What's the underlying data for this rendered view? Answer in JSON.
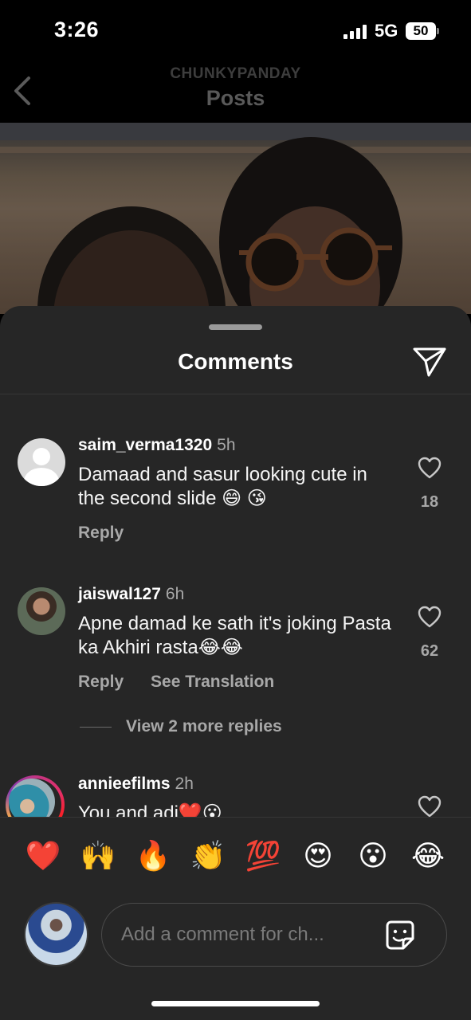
{
  "status_bar": {
    "time": "3:26",
    "network": "5G",
    "battery": "50"
  },
  "header": {
    "username": "CHUNKYPANDAY",
    "title": "Posts"
  },
  "sheet": {
    "title": "Comments"
  },
  "comments": [
    {
      "username": "saim_verma1320",
      "time": "5h",
      "text": "Damaad and sasur looking cute in the second slide 😄 😘",
      "likes": "18",
      "reply_label": "Reply"
    },
    {
      "username": "jaiswal127",
      "time": "6h",
      "text": "Apne damad ke sath it's joking Pasta ka Akhiri rasta😂😂",
      "likes": "62",
      "reply_label": "Reply",
      "translate_label": "See Translation",
      "view_replies": "View 2 more replies"
    },
    {
      "username": "annieefilms",
      "time": "2h",
      "text": "You and adi❤️😮"
    }
  ],
  "emoji_bar": [
    "❤️",
    "🙌",
    "🔥",
    "👏",
    "💯",
    "😍",
    "😮",
    "😂"
  ],
  "composer": {
    "placeholder": "Add a comment for ch..."
  }
}
